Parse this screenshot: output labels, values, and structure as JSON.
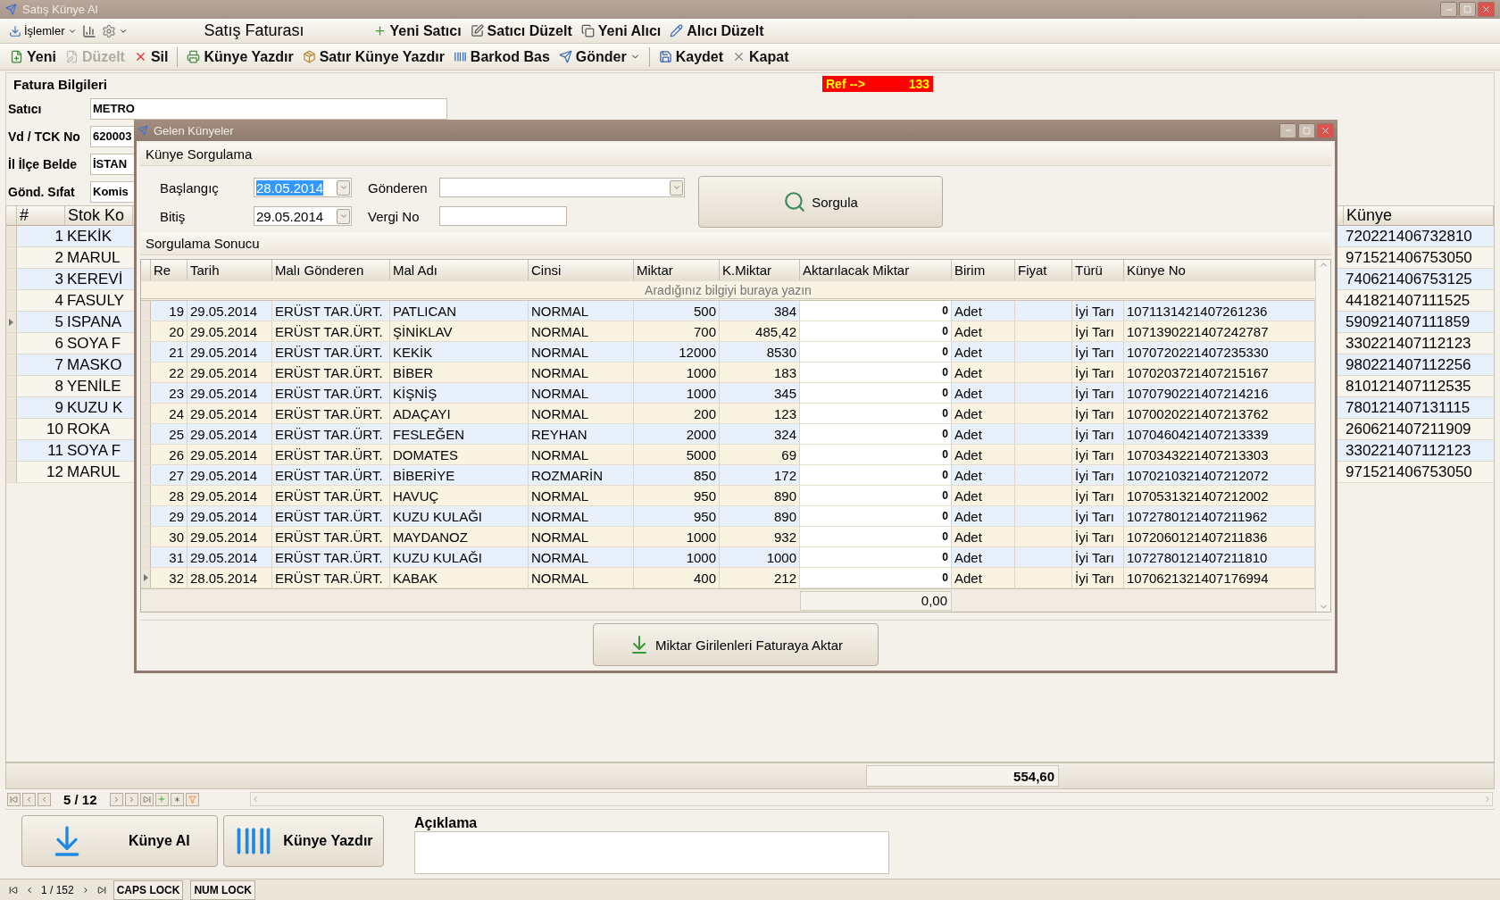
{
  "app": {
    "title": "Satış Künye Al"
  },
  "toolbar_top": {
    "menu": "İşlemler",
    "title": "Satış Faturası",
    "actions": [
      {
        "label": "Yeni Satıcı",
        "kind": "add"
      },
      {
        "label": "Satıcı Düzelt",
        "kind": "edit"
      },
      {
        "label": "Yeni Alıcı",
        "kind": "copy"
      },
      {
        "label": "Alıcı Düzelt",
        "kind": "pencil"
      }
    ]
  },
  "toolbar_main": {
    "groups": [
      [
        {
          "label": "Yeni",
          "kind": "new",
          "disabled": false
        },
        {
          "label": "Düzelt",
          "kind": "edit",
          "disabled": true
        },
        {
          "label": "Sil",
          "kind": "delete",
          "disabled": false
        }
      ],
      [
        {
          "label": "Künye Yazdır",
          "kind": "print",
          "disabled": false
        },
        {
          "label": "Satır Künye Yazdır",
          "kind": "box",
          "disabled": false
        },
        {
          "label": "Barkod Bas",
          "kind": "barcode",
          "disabled": false
        },
        {
          "label": "Gönder",
          "kind": "send",
          "disabled": false
        }
      ],
      [
        {
          "label": "Kaydet",
          "kind": "save",
          "disabled": false
        },
        {
          "label": "Kapat",
          "kind": "close",
          "disabled": false
        }
      ]
    ]
  },
  "invoice": {
    "header": "Fatura Bilgileri",
    "ref_label": "Ref -->",
    "ref_value": "133",
    "fields": [
      {
        "label": "Satıcı",
        "value": "METRO"
      },
      {
        "label": "Vd / TCK No",
        "value": "620003"
      },
      {
        "label": "İl İlçe Belde",
        "value": "İSTAN"
      },
      {
        "label": "Gönd. Sıfat",
        "value": "Komis"
      }
    ]
  },
  "stock_grid": {
    "columns": [
      "#",
      "Stok Ko",
      "Künye"
    ],
    "rows": [
      {
        "no": "1",
        "stock": "KEKİK",
        "kunye": "720221406732810",
        "current": false
      },
      {
        "no": "2",
        "stock": "MARUL",
        "kunye": "971521406753050",
        "current": false
      },
      {
        "no": "3",
        "stock": "KEREVİ",
        "kunye": "740621406753125",
        "current": false
      },
      {
        "no": "4",
        "stock": "FASULY",
        "kunye": "441821407111525",
        "current": false
      },
      {
        "no": "5",
        "stock": "ISPANA",
        "kunye": "590921407111859",
        "current": true
      },
      {
        "no": "6",
        "stock": "SOYA F",
        "kunye": "330221407112123",
        "current": false
      },
      {
        "no": "7",
        "stock": "MASKO",
        "kunye": "980221407112256",
        "current": false
      },
      {
        "no": "8",
        "stock": "YENİLE",
        "kunye": "810121407112535",
        "current": false
      },
      {
        "no": "9",
        "stock": "KUZU K",
        "kunye": "780121407131115",
        "current": false
      },
      {
        "no": "10",
        "stock": "ROKA",
        "kunye": "260621407211909",
        "current": false
      },
      {
        "no": "11",
        "stock": "SOYA F",
        "kunye": "330221407112123",
        "current": false
      },
      {
        "no": "12",
        "stock": "MARUL",
        "kunye": "971521406753050",
        "current": false
      }
    ]
  },
  "totals": {
    "sum": "554,60"
  },
  "navigator": {
    "position": "5 / 12"
  },
  "buttons": [
    {
      "label": "Künye Al",
      "kind": "download"
    },
    {
      "label": "Künye Yazdır",
      "kind": "barcode"
    }
  ],
  "note": {
    "label": "Açıklama"
  },
  "status_bar": {
    "record": "1 / 152",
    "keys": [
      "CAPS LOCK",
      "NUM LOCK"
    ]
  },
  "dialog": {
    "title": "Gelen Künyeler",
    "query": {
      "header": "Künye Sorgulama",
      "start_label": "Başlangıç",
      "start_value": "28.05.2014",
      "start_text_selected": true,
      "end_label": "Bitiş",
      "end_value": "29.05.2014",
      "sender_label": "Gönderen",
      "tax_label": "Vergi No",
      "button": "Sorgula"
    },
    "results": {
      "header": "Sorgulama Sonucu",
      "columns": [
        "Re",
        "Tarih",
        "Malı Gönderen",
        "Mal Adı",
        "Cinsi",
        "Miktar",
        "K.Miktar",
        "Aktarılacak Miktar",
        "Birim",
        "Fiyat",
        "Türü",
        "Künye No"
      ],
      "filter_placeholder": "Aradığınız bilgiyi buraya yazın",
      "rows": [
        {
          "re": "19",
          "date": "29.05.2014",
          "sender": "ERÜST TAR.ÜRT.",
          "product": "PATLICAN",
          "type": "NORMAL",
          "qty": "500",
          "kqty": "384",
          "transfer": "0",
          "unit": "Adet",
          "category": "İyi Tarı",
          "kunye": "1071131421407261236",
          "current": false
        },
        {
          "re": "20",
          "date": "29.05.2014",
          "sender": "ERÜST TAR.ÜRT.",
          "product": "ŞİNİKLAV",
          "type": "NORMAL",
          "qty": "700",
          "kqty": "485,42",
          "transfer": "0",
          "unit": "Adet",
          "category": "İyi Tarı",
          "kunye": "1071390221407242787",
          "current": false
        },
        {
          "re": "21",
          "date": "29.05.2014",
          "sender": "ERÜST TAR.ÜRT.",
          "product": "KEKİK",
          "type": "NORMAL",
          "qty": "12000",
          "kqty": "8530",
          "transfer": "0",
          "unit": "Adet",
          "category": "İyi Tarı",
          "kunye": "1070720221407235330",
          "current": false
        },
        {
          "re": "22",
          "date": "29.05.2014",
          "sender": "ERÜST TAR.ÜRT.",
          "product": "BİBER",
          "type": "NORMAL",
          "qty": "1000",
          "kqty": "183",
          "transfer": "0",
          "unit": "Adet",
          "category": "İyi Tarı",
          "kunye": "1070203721407215167",
          "current": false
        },
        {
          "re": "23",
          "date": "29.05.2014",
          "sender": "ERÜST TAR.ÜRT.",
          "product": "KİŞNİŞ",
          "type": "NORMAL",
          "qty": "1000",
          "kqty": "345",
          "transfer": "0",
          "unit": "Adet",
          "category": "İyi Tarı",
          "kunye": "1070790221407214216",
          "current": false
        },
        {
          "re": "24",
          "date": "29.05.2014",
          "sender": "ERÜST TAR.ÜRT.",
          "product": "ADAÇAYI",
          "type": "NORMAL",
          "qty": "200",
          "kqty": "123",
          "transfer": "0",
          "unit": "Adet",
          "category": "İyi Tarı",
          "kunye": "1070020221407213762",
          "current": false
        },
        {
          "re": "25",
          "date": "29.05.2014",
          "sender": "ERÜST TAR.ÜRT.",
          "product": "FESLEĞEN",
          "type": "REYHAN",
          "qty": "2000",
          "kqty": "324",
          "transfer": "0",
          "unit": "Adet",
          "category": "İyi Tarı",
          "kunye": "1070460421407213339",
          "current": false
        },
        {
          "re": "26",
          "date": "29.05.2014",
          "sender": "ERÜST TAR.ÜRT.",
          "product": "DOMATES",
          "type": "NORMAL",
          "qty": "5000",
          "kqty": "69",
          "transfer": "0",
          "unit": "Adet",
          "category": "İyi Tarı",
          "kunye": "1070343221407213303",
          "current": false
        },
        {
          "re": "27",
          "date": "29.05.2014",
          "sender": "ERÜST TAR.ÜRT.",
          "product": "BİBERİYE",
          "type": "ROZMARİN",
          "qty": "850",
          "kqty": "172",
          "transfer": "0",
          "unit": "Adet",
          "category": "İyi Tarı",
          "kunye": "1070210321407212072",
          "current": false
        },
        {
          "re": "28",
          "date": "29.05.2014",
          "sender": "ERÜST TAR.ÜRT.",
          "product": "HAVUÇ",
          "type": "NORMAL",
          "qty": "950",
          "kqty": "890",
          "transfer": "0",
          "unit": "Adet",
          "category": "İyi Tarı",
          "kunye": "1070531321407212002",
          "current": false
        },
        {
          "re": "29",
          "date": "29.05.2014",
          "sender": "ERÜST TAR.ÜRT.",
          "product": "KUZU KULAĞI",
          "type": "NORMAL",
          "qty": "950",
          "kqty": "890",
          "transfer": "0",
          "unit": "Adet",
          "category": "İyi Tarı",
          "kunye": "1072780121407211962",
          "current": false
        },
        {
          "re": "30",
          "date": "29.05.2014",
          "sender": "ERÜST TAR.ÜRT.",
          "product": "MAYDANOZ",
          "type": "NORMAL",
          "qty": "1000",
          "kqty": "932",
          "transfer": "0",
          "unit": "Adet",
          "category": "İyi Tarı",
          "kunye": "1072060121407211836",
          "current": false
        },
        {
          "re": "31",
          "date": "29.05.2014",
          "sender": "ERÜST TAR.ÜRT.",
          "product": "KUZU KULAĞI",
          "type": "NORMAL",
          "qty": "1000",
          "kqty": "1000",
          "transfer": "0",
          "unit": "Adet",
          "category": "İyi Tarı",
          "kunye": "1072780121407211810",
          "current": false
        },
        {
          "re": "32",
          "date": "28.05.2014",
          "sender": "ERÜST TAR.ÜRT.",
          "product": "KABAK",
          "type": "NORMAL",
          "qty": "400",
          "kqty": "212",
          "transfer": "0",
          "unit": "Adet",
          "category": "İyi Tarı",
          "kunye": "1070621321407176994",
          "current": true
        }
      ],
      "total": "0,00",
      "transfer_button": "Miktar Girilenleri Faturaya Aktar"
    }
  }
}
